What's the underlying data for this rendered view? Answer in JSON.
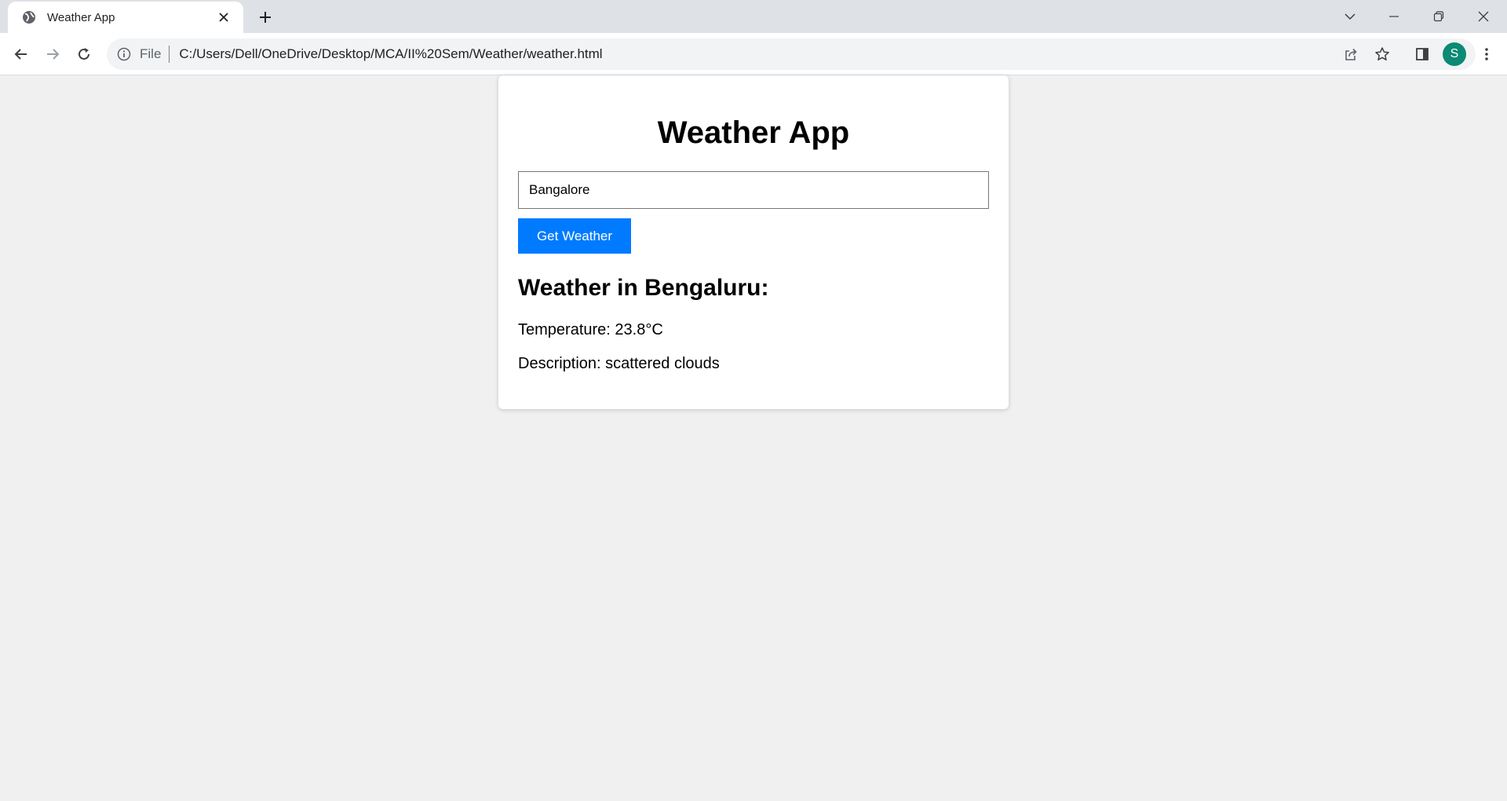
{
  "browser": {
    "tab": {
      "title": "Weather App",
      "favicon": "globe-icon"
    },
    "address": {
      "scheme": "File",
      "url": "C:/Users/Dell/OneDrive/Desktop/MCA/II%20Sem/Weather/weather.html"
    },
    "profile_initial": "S",
    "profile_color": "#0b8a76"
  },
  "app": {
    "title": "Weather App",
    "city_input": {
      "value": "Bangalore"
    },
    "button_label": "Get Weather",
    "button_color": "#007bff",
    "result": {
      "heading": "Weather in Bengaluru:",
      "temperature": "Temperature: 23.8°C",
      "description": "Description: scattered clouds"
    }
  }
}
